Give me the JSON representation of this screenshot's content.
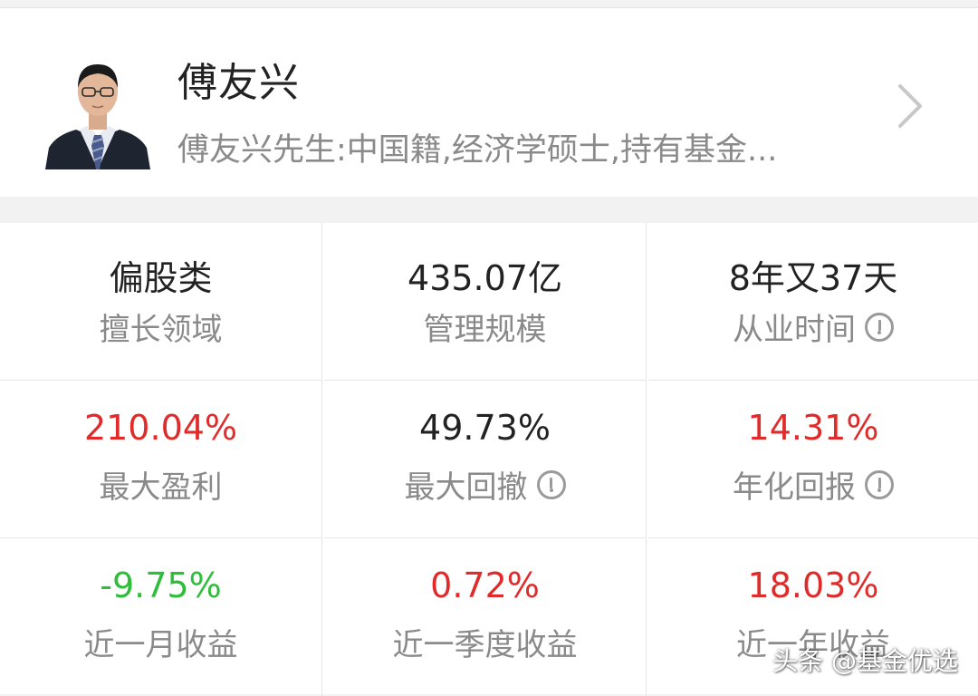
{
  "manager": {
    "name": "傅友兴",
    "description": "傅友兴先生:中国籍,经济学硕士,持有基金..."
  },
  "stats": [
    {
      "value": "偏股类",
      "label": "擅长领域",
      "info": false,
      "color": "default"
    },
    {
      "value": "435.07亿",
      "label": "管理规模",
      "info": false,
      "color": "default"
    },
    {
      "value": "8年又37天",
      "label": "从业时间",
      "info": true,
      "color": "default"
    },
    {
      "value": "210.04%",
      "label": "最大盈利",
      "info": false,
      "color": "red"
    },
    {
      "value": "49.73%",
      "label": "最大回撤",
      "info": true,
      "color": "default"
    },
    {
      "value": "14.31%",
      "label": "年化回报",
      "info": true,
      "color": "red"
    },
    {
      "value": "-9.75%",
      "label": "近一月收益",
      "info": false,
      "color": "green"
    },
    {
      "value": "0.72%",
      "label": "近一季度收益",
      "info": false,
      "color": "red"
    },
    {
      "value": "18.03%",
      "label": "近一年收益",
      "info": false,
      "color": "red"
    }
  ],
  "icons": {
    "chevron": "chevron-right-icon",
    "info": "info-icon",
    "avatar": "manager-photo"
  },
  "watermark": "头条 @基金优选",
  "colors": {
    "up": "#e12a2a",
    "down": "#2fbe3a",
    "text": "#222222",
    "muted": "#8a8a8a"
  }
}
